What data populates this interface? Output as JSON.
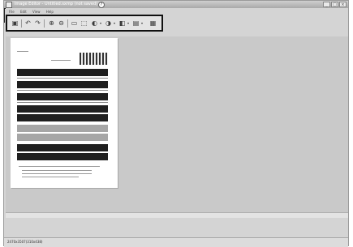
{
  "window": {
    "title": "Image Editor - Untitled.sxmp (not saved)",
    "help_glyph": "?",
    "minimize_glyph": "_",
    "maximize_glyph": "□",
    "close_glyph": "×"
  },
  "menubar": {
    "items": [
      "File",
      "Edit",
      "View",
      "Help"
    ]
  },
  "toolbar": {
    "buttons": [
      {
        "name": "save-icon",
        "glyph": "▣"
      },
      {
        "name": "rotate-left-icon",
        "glyph": "↶"
      },
      {
        "name": "rotate-right-icon",
        "glyph": "↷"
      },
      {
        "name": "zoom-in-icon",
        "glyph": "⊕"
      },
      {
        "name": "zoom-out-icon",
        "glyph": "⊖"
      },
      {
        "name": "crop-icon",
        "glyph": "▭"
      },
      {
        "name": "select-icon",
        "glyph": "⬚"
      },
      {
        "name": "brightness-icon",
        "glyph": "◐"
      },
      {
        "name": "contrast-icon",
        "glyph": "◑"
      },
      {
        "name": "color-icon",
        "glyph": "◧"
      },
      {
        "name": "effects-icon",
        "glyph": "▤"
      },
      {
        "name": "properties-icon",
        "glyph": "▦"
      }
    ],
    "dropdown_glyph": "▾"
  },
  "status": {
    "text": "2470x3507(310x438)"
  }
}
